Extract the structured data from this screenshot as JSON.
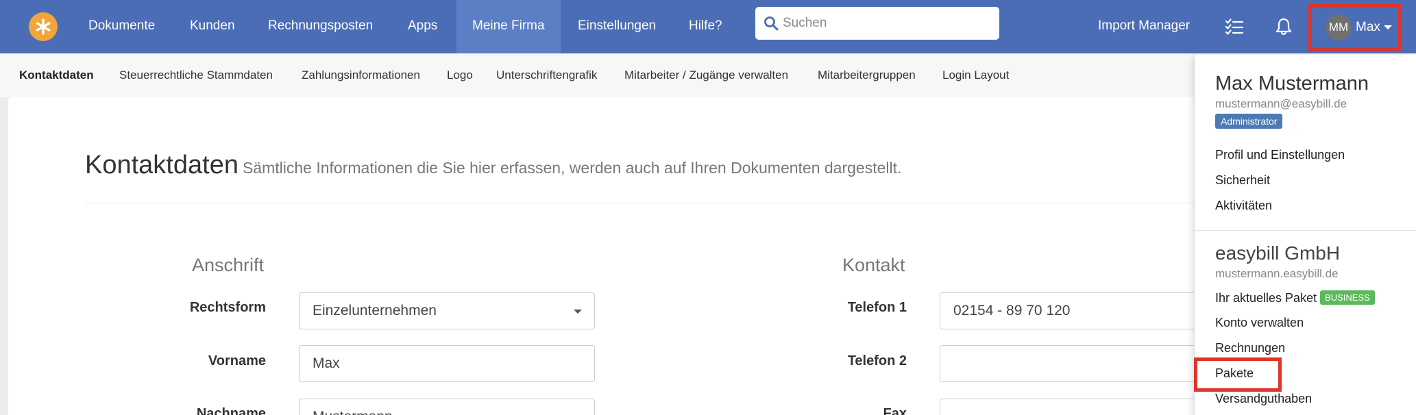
{
  "nav": {
    "items": [
      "Dokumente",
      "Kunden",
      "Rechnungsposten",
      "Apps",
      "Meine Firma",
      "Einstellungen",
      "Hilfe?"
    ],
    "active": "Meine Firma",
    "search_placeholder": "Suchen",
    "import_manager": "Import Manager",
    "user_initials": "MM",
    "user_name": "Max"
  },
  "subnav": {
    "items": [
      "Kontaktdaten",
      "Steuerrechtliche Stammdaten",
      "Zahlungsinformationen",
      "Logo",
      "Unterschriftengrafik",
      "Mitarbeiter / Zugänge verwalten",
      "Mitarbeitergruppen",
      "Login Layout"
    ],
    "active": "Kontaktdaten"
  },
  "page": {
    "title": "Kontaktdaten",
    "subtitle": "Sämtliche Informationen die Sie hier erfassen, werden auch auf Ihren Dokumenten dargestellt.",
    "anschrift": {
      "heading": "Anschrift",
      "rechtsform_label": "Rechtsform",
      "rechtsform_value": "Einzelunternehmen",
      "vorname_label": "Vorname",
      "vorname_value": "Max",
      "nachname_label": "Nachname",
      "nachname_value": "Mustermann"
    },
    "kontakt": {
      "heading": "Kontakt",
      "telefon1_label": "Telefon 1",
      "telefon1_value": "02154 - 89 70 120",
      "telefon2_label": "Telefon 2",
      "telefon2_value": "",
      "fax_label": "Fax",
      "fax_value": ""
    }
  },
  "dropdown": {
    "name": "Max Mustermann",
    "email": "mustermann@easybill.de",
    "role_badge": "Administrator",
    "user_items": [
      "Profil und Einstellungen",
      "Sicherheit",
      "Aktivitäten"
    ],
    "company": "easybill GmbH",
    "company_domain": "mustermann.easybill.de",
    "current_package_label": "Ihr aktuelles Paket",
    "package_badge": "BUSINESS",
    "company_items": [
      "Konto verwalten",
      "Rechnungen",
      "Pakete",
      "Versandguthaben"
    ]
  },
  "colors": {
    "nav_bg": "#4b6db6",
    "nav_active": "#5b7fc4",
    "logo": "#f2a53a",
    "highlight": "#e0342a",
    "badge_admin": "#4b7ab5",
    "badge_business": "#5cb85c"
  }
}
